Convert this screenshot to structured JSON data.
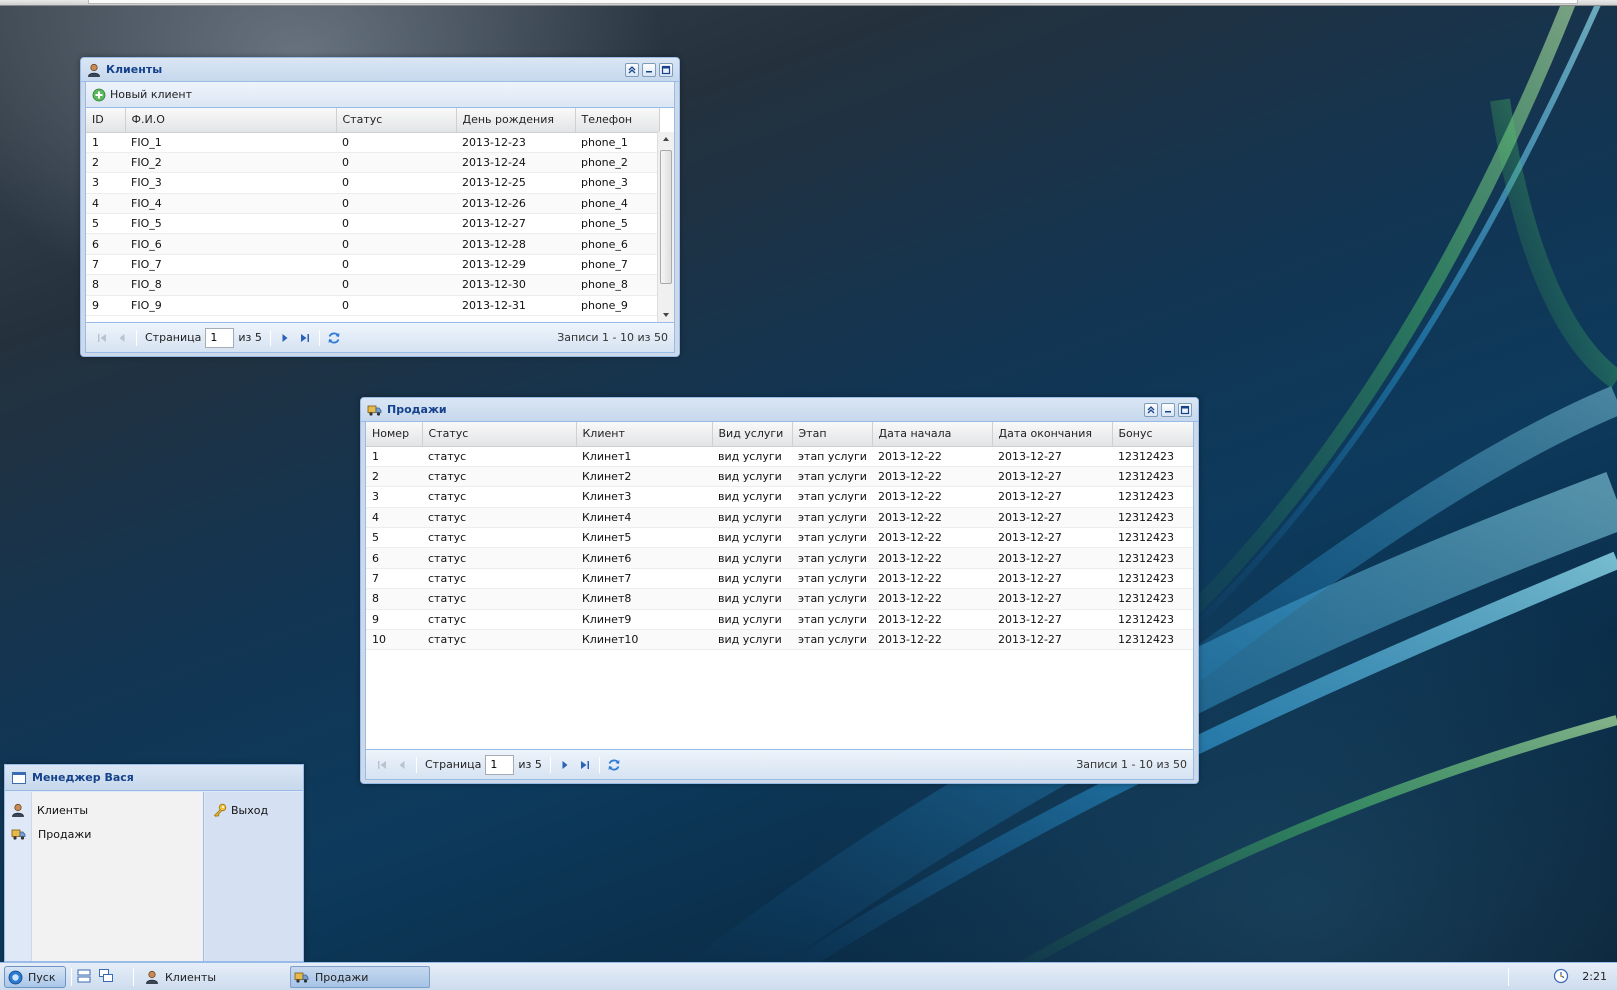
{
  "clients_window": {
    "title": "Клиенты",
    "toolbar": {
      "new_client_label": "Новый клиент"
    },
    "columns": [
      "ID",
      "Ф.И.О",
      "Статус",
      "День рождения",
      "Телефон"
    ],
    "rows": [
      [
        "1",
        "FIO_1",
        "0",
        "2013-12-23",
        "phone_1"
      ],
      [
        "2",
        "FIO_2",
        "0",
        "2013-12-24",
        "phone_2"
      ],
      [
        "3",
        "FIO_3",
        "0",
        "2013-12-25",
        "phone_3"
      ],
      [
        "4",
        "FIO_4",
        "0",
        "2013-12-26",
        "phone_4"
      ],
      [
        "5",
        "FIO_5",
        "0",
        "2013-12-27",
        "phone_5"
      ],
      [
        "6",
        "FIO_6",
        "0",
        "2013-12-28",
        "phone_6"
      ],
      [
        "7",
        "FIO_7",
        "0",
        "2013-12-29",
        "phone_7"
      ],
      [
        "8",
        "FIO_8",
        "0",
        "2013-12-30",
        "phone_8"
      ],
      [
        "9",
        "FIO_9",
        "0",
        "2013-12-31",
        "phone_9"
      ]
    ],
    "pager": {
      "page_label": "Страница",
      "page_value": "1",
      "of_label": "из 5",
      "info": "Записи 1 - 10 из 50"
    }
  },
  "sales_window": {
    "title": "Продажи",
    "columns": [
      "Номер",
      "Статус",
      "Клиент",
      "Вид услуги",
      "Этап",
      "Дата начала",
      "Дата окончания",
      "Бонус"
    ],
    "rows": [
      [
        "1",
        "статус",
        "Клинет1",
        "вид услуги",
        "этап услуги",
        "2013-12-22",
        "2013-12-27",
        "12312423"
      ],
      [
        "2",
        "статус",
        "Клинет2",
        "вид услуги",
        "этап услуги",
        "2013-12-22",
        "2013-12-27",
        "12312423"
      ],
      [
        "3",
        "статус",
        "Клинет3",
        "вид услуги",
        "этап услуги",
        "2013-12-22",
        "2013-12-27",
        "12312423"
      ],
      [
        "4",
        "статус",
        "Клинет4",
        "вид услуги",
        "этап услуги",
        "2013-12-22",
        "2013-12-27",
        "12312423"
      ],
      [
        "5",
        "статус",
        "Клинет5",
        "вид услуги",
        "этап услуги",
        "2013-12-22",
        "2013-12-27",
        "12312423"
      ],
      [
        "6",
        "статус",
        "Клинет6",
        "вид услуги",
        "этап услуги",
        "2013-12-22",
        "2013-12-27",
        "12312423"
      ],
      [
        "7",
        "статус",
        "Клинет7",
        "вид услуги",
        "этап услуги",
        "2013-12-22",
        "2013-12-27",
        "12312423"
      ],
      [
        "8",
        "статус",
        "Клинет8",
        "вид услуги",
        "этап услуги",
        "2013-12-22",
        "2013-12-27",
        "12312423"
      ],
      [
        "9",
        "статус",
        "Клинет9",
        "вид услуги",
        "этап услуги",
        "2013-12-22",
        "2013-12-27",
        "12312423"
      ],
      [
        "10",
        "статус",
        "Клинет10",
        "вид услуги",
        "этап услуги",
        "2013-12-22",
        "2013-12-27",
        "12312423"
      ]
    ],
    "pager": {
      "page_label": "Страница",
      "page_value": "1",
      "of_label": "из 5",
      "info": "Записи 1 - 10 из 50"
    }
  },
  "start_menu": {
    "title": "Менеджер Вася",
    "items": [
      {
        "label": "Клиенты",
        "icon": "user-icon"
      },
      {
        "label": "Продажи",
        "icon": "truck-icon"
      }
    ],
    "tools": [
      {
        "label": "Выход",
        "icon": "key-icon"
      }
    ]
  },
  "taskbar": {
    "start_label": "Пуск",
    "tasks": [
      {
        "label": "Клиенты",
        "icon": "user-icon"
      },
      {
        "label": "Продажи",
        "icon": "truck-icon"
      }
    ],
    "clock": "2:21"
  },
  "colors": {
    "header_title": "#15428b",
    "window_border": "#99bbe8",
    "panel_bg": "#dfe8f6"
  }
}
